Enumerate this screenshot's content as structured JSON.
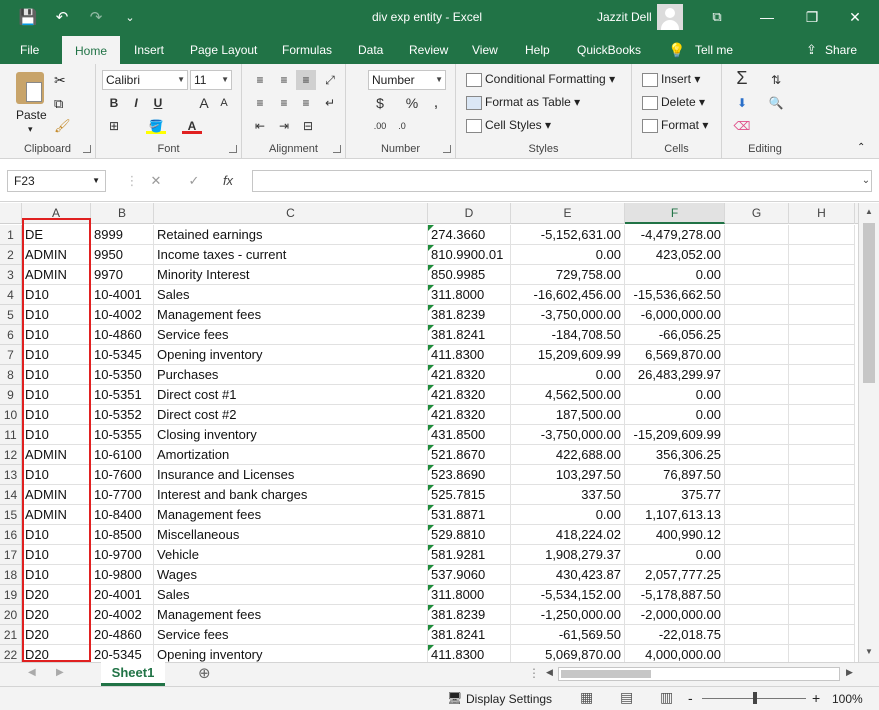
{
  "window": {
    "document_title": "div exp entity  -  Excel",
    "user_name": "Jazzit Dell",
    "buttons": {
      "minimize": "—",
      "restore": "❐",
      "close": "✕",
      "ribbon_options": "⧉"
    }
  },
  "quick_access": {
    "save": "💾",
    "undo": "↶",
    "redo": "↷",
    "customize": "⌄"
  },
  "tabs": [
    "File",
    "Home",
    "Insert",
    "Page Layout",
    "Formulas",
    "Data",
    "Review",
    "View",
    "Help",
    "QuickBooks",
    "Tell me",
    "Share"
  ],
  "ribbon": {
    "clipboard": {
      "label": "Clipboard",
      "paste": "Paste"
    },
    "font": {
      "label": "Font",
      "name": "Calibri",
      "size": "11",
      "bold": "B",
      "italic": "I",
      "underline": "U",
      "grow": "A",
      "shrink": "A",
      "font_color": "A"
    },
    "alignment": {
      "label": "Alignment"
    },
    "number": {
      "label": "Number",
      "format": "Number",
      "currency": "$",
      "percent": "%",
      "comma": ","
    },
    "styles": {
      "label": "Styles",
      "conditional": "Conditional Formatting",
      "table": "Format as Table",
      "cell_styles": "Cell Styles"
    },
    "cells": {
      "label": "Cells",
      "insert": "Insert",
      "delete": "Delete",
      "format": "Format"
    },
    "editing": {
      "label": "Editing"
    }
  },
  "formula_bar": {
    "name_box": "F23",
    "cancel": "✕",
    "enter": "✓",
    "fx": "fx",
    "value": ""
  },
  "columns": [
    "A",
    "B",
    "C",
    "D",
    "E",
    "F",
    "G",
    "H"
  ],
  "rows": [
    [
      "DE",
      "8999",
      "Retained earnings",
      "274.3660",
      "-5,152,631.00",
      "-4,479,278.00"
    ],
    [
      "ADMIN",
      "9950",
      "Income taxes - current",
      "810.9900.01",
      "0.00",
      "423,052.00"
    ],
    [
      "ADMIN",
      "9970",
      "Minority Interest",
      "850.9985",
      "729,758.00",
      "0.00"
    ],
    [
      "D10",
      "10-4001",
      "Sales",
      "311.8000",
      "-16,602,456.00",
      "-15,536,662.50"
    ],
    [
      "D10",
      "10-4002",
      "Management fees",
      "381.8239",
      "-3,750,000.00",
      "-6,000,000.00"
    ],
    [
      "D10",
      "10-4860",
      "Service fees",
      "381.8241",
      "-184,708.50",
      "-66,056.25"
    ],
    [
      "D10",
      "10-5345",
      "Opening inventory",
      "411.8300",
      "15,209,609.99",
      "6,569,870.00"
    ],
    [
      "D10",
      "10-5350",
      "Purchases",
      "421.8320",
      "0.00",
      "26,483,299.97"
    ],
    [
      "D10",
      "10-5351",
      "Direct cost #1",
      "421.8320",
      "4,562,500.00",
      "0.00"
    ],
    [
      "D10",
      "10-5352",
      "Direct cost #2",
      "421.8320",
      "187,500.00",
      "0.00"
    ],
    [
      "D10",
      "10-5355",
      "Closing inventory",
      "431.8500",
      "-3,750,000.00",
      "-15,209,609.99"
    ],
    [
      "ADMIN",
      "10-6100",
      "Amortization",
      "521.8670",
      "422,688.00",
      "356,306.25"
    ],
    [
      "D10",
      "10-7600",
      "Insurance and Licenses",
      "523.8690",
      "103,297.50",
      "76,897.50"
    ],
    [
      "ADMIN",
      "10-7700",
      "Interest and bank charges",
      "525.7815",
      "337.50",
      "375.77"
    ],
    [
      "ADMIN",
      "10-8400",
      "Management fees",
      "531.8871",
      "0.00",
      "1,107,613.13"
    ],
    [
      "D10",
      "10-8500",
      "Miscellaneous",
      "529.8810",
      "418,224.02",
      "400,990.12"
    ],
    [
      "D10",
      "10-9700",
      "Vehicle",
      "581.9281",
      "1,908,279.37",
      "0.00"
    ],
    [
      "D10",
      "10-9800",
      "Wages",
      "537.9060",
      "430,423.87",
      "2,057,777.25"
    ],
    [
      "D20",
      "20-4001",
      "Sales",
      "311.8000",
      "-5,534,152.00",
      "-5,178,887.50"
    ],
    [
      "D20",
      "20-4002",
      "Management fees",
      "381.8239",
      "-1,250,000.00",
      "-2,000,000.00"
    ],
    [
      "D20",
      "20-4860",
      "Service fees",
      "381.8241",
      "-61,569.50",
      "-22,018.75"
    ],
    [
      "D20",
      "20-5345",
      "Opening inventory",
      "411.8300",
      "5,069,870.00",
      "4,000,000.00"
    ]
  ],
  "sheet_tabs": [
    "Sheet1"
  ],
  "status": {
    "display_settings": "Display Settings",
    "zoom": "100%",
    "zoom_minus": "-",
    "zoom_plus": "+"
  },
  "colors": {
    "accent": "#217346",
    "highlight_box": "#e02020",
    "error_indicator": "#1e8c3a"
  }
}
